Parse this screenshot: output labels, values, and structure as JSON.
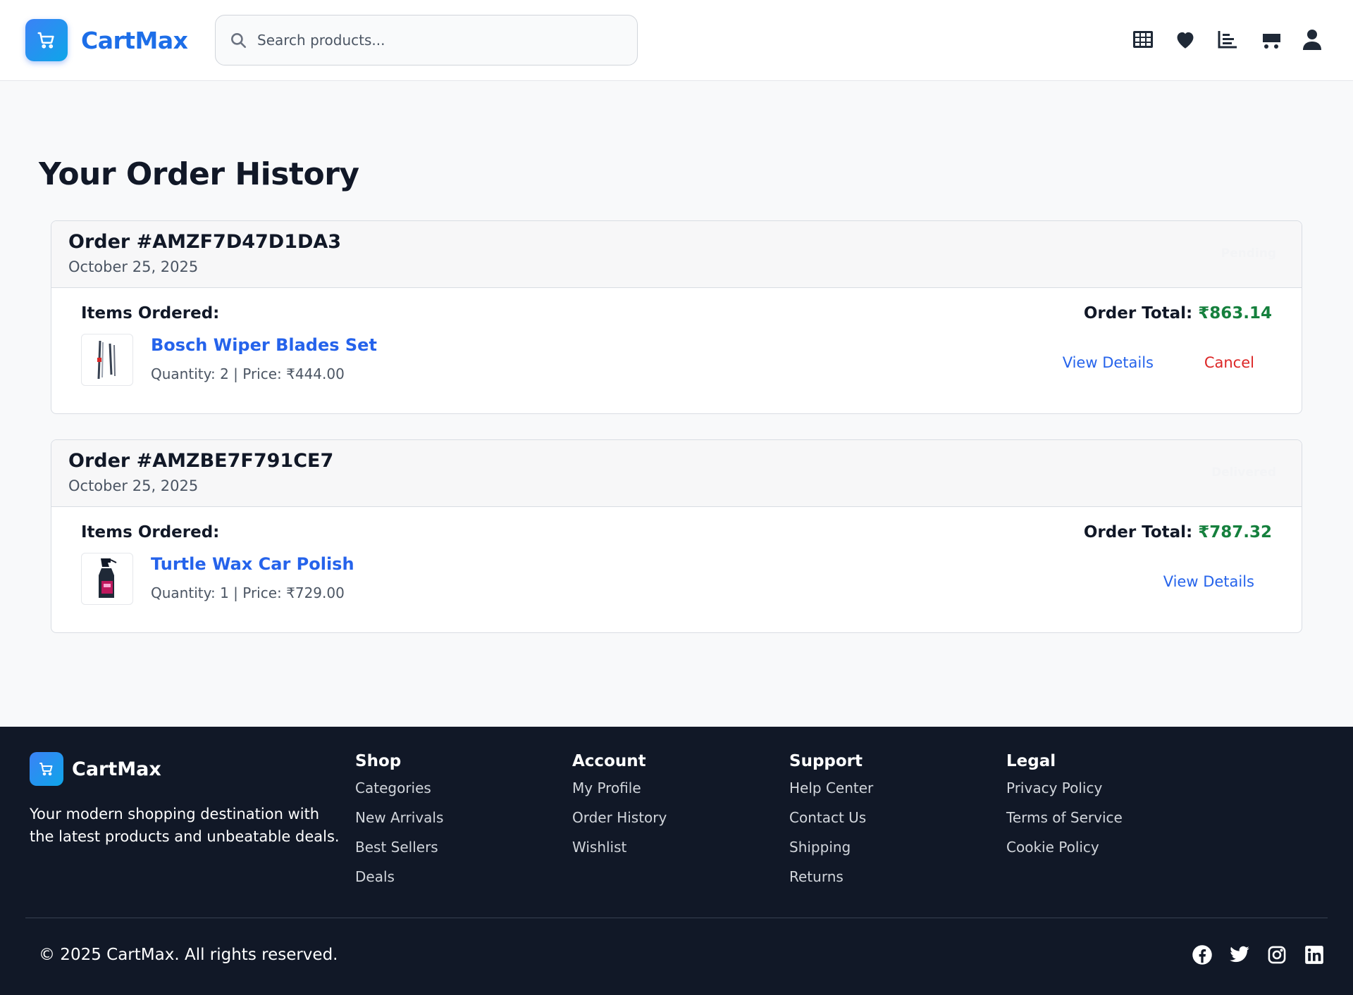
{
  "brand": {
    "name": "CartMax"
  },
  "search": {
    "placeholder": "Search products..."
  },
  "nav_icons": [
    "grid-icon",
    "heart-icon",
    "bar-chart-icon",
    "cart-icon",
    "user-icon"
  ],
  "page": {
    "title": "Your Order History"
  },
  "orders": [
    {
      "id": "Order #AMZF7D47D1DA3",
      "date": "October 25, 2025",
      "status": "Pending",
      "items_label": "Items Ordered:",
      "total_label": "Order Total:",
      "total": "₹863.14",
      "item": {
        "name": "Bosch Wiper Blades Set",
        "meta": "Quantity: 2 | Price: ₹444.00"
      },
      "actions": {
        "view": "View Details",
        "cancel": "Cancel"
      }
    },
    {
      "id": "Order #AMZBE7F791CE7",
      "date": "October 25, 2025",
      "status": "Delivered",
      "items_label": "Items Ordered:",
      "total_label": "Order Total:",
      "total": "₹787.32",
      "item": {
        "name": "Turtle Wax Car Polish",
        "meta": "Quantity: 1 | Price: ₹729.00"
      },
      "actions": {
        "view": "View Details"
      }
    }
  ],
  "footer": {
    "brand": "CartMax",
    "tagline": "Your modern shopping destination with the latest products and unbeatable deals.",
    "columns": [
      {
        "title": "Shop",
        "links": [
          "Categories",
          "New Arrivals",
          "Best Sellers",
          "Deals"
        ]
      },
      {
        "title": "Account",
        "links": [
          "My Profile",
          "Order History",
          "Wishlist"
        ]
      },
      {
        "title": "Support",
        "links": [
          "Help Center",
          "Contact Us",
          "Shipping",
          "Returns"
        ]
      },
      {
        "title": "Legal",
        "links": [
          "Privacy Policy",
          "Terms of Service",
          "Cookie Policy"
        ]
      }
    ],
    "copyright": "© 2025 CartMax. All rights reserved.",
    "social": [
      "facebook-icon",
      "twitter-icon",
      "instagram-icon",
      "linkedin-icon"
    ]
  },
  "colors": {
    "brand": "#1d6ee8",
    "link": "#2563eb",
    "total": "#15803d",
    "cancel": "#dc2626",
    "footer_bg": "#111827"
  }
}
